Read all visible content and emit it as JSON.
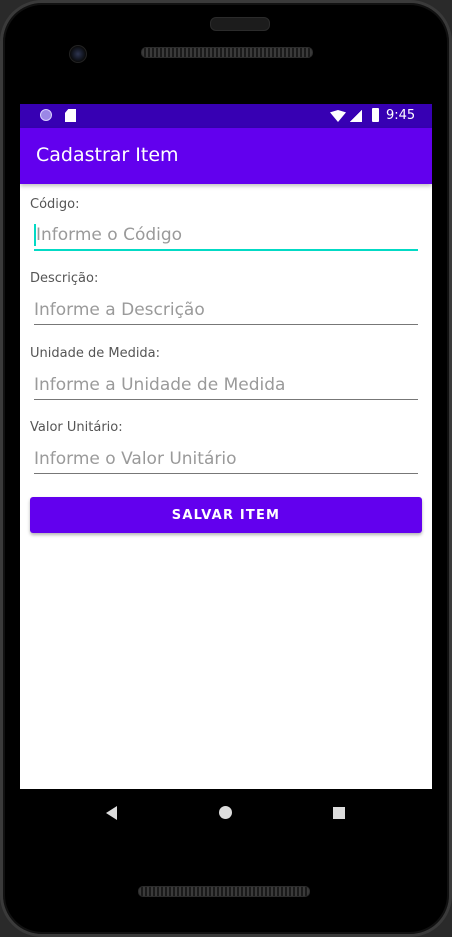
{
  "statusbar": {
    "time": "9:45",
    "icons": [
      "notification-circle-icon",
      "sd-card-icon",
      "wifi-icon",
      "signal-icon",
      "battery-icon"
    ]
  },
  "appbar": {
    "title": "Cadastrar Item"
  },
  "form": {
    "fields": [
      {
        "label": "Código:",
        "placeholder": "Informe o Código",
        "value": ""
      },
      {
        "label": "Descrição:",
        "placeholder": "Informe a Descrição",
        "value": ""
      },
      {
        "label": "Unidade de Medida:",
        "placeholder": "Informe a Unidade de Medida",
        "value": ""
      },
      {
        "label": "Valor Unitário:",
        "placeholder": "Informe o Valor Unitário",
        "value": ""
      }
    ],
    "submit_label": "SALVAR ITEM"
  },
  "navbar": {
    "icons": [
      "back-icon",
      "home-icon",
      "recents-icon"
    ]
  },
  "colors": {
    "status_bar": "#3700b3",
    "primary": "#6200ee",
    "accent": "#03dac5"
  }
}
